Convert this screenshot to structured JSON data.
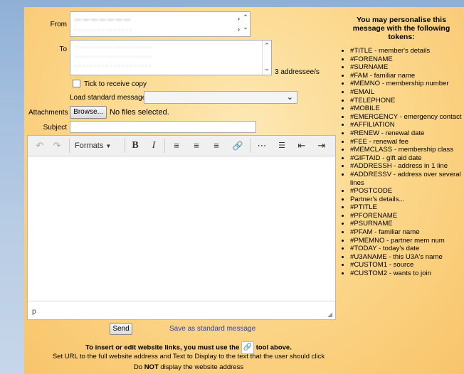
{
  "form": {
    "from_label": "From",
    "from_lines": [
      "— — — — — — — ",
      "·  · · · · · ·  · · · · · ·  · ·"
    ],
    "to_label": "To",
    "to_lines": [
      "· · · · · · · · · · · · · · · · · · · ·",
      "· · · · · · · · · · · · · · · · · · · ·",
      "· · · · · · · · · · · · · · · · · · · ·"
    ],
    "addressee_count": "3 addressee/s",
    "receive_copy_label": "Tick to receive copy",
    "load_message_label": "Load standard message",
    "load_message_value": "",
    "attachments_label": "Attachments",
    "browse_label": "Browse...",
    "files_status": "No files selected.",
    "subject_label": "Subject",
    "subject_value": ""
  },
  "editor": {
    "formats_label": "Formats",
    "status_path": "p"
  },
  "actions": {
    "send_label": "Send",
    "save_label": "Save as standard message"
  },
  "notes": {
    "line1_before": "To insert or edit website links, you must use the",
    "line1_after": "tool above.",
    "line2": "Set URL to the full website address and Text to Display to the text that the user should click",
    "line3_before": "Do",
    "line3_bold": "NOT",
    "line3_after": "display the website address"
  },
  "tokens": {
    "title": "You may personalise this message with the following tokens:",
    "items": [
      "#TITLE - member's details",
      "#FORENAME",
      "#SURNAME",
      "#FAM - familiar name",
      "#MEMNO - membership number",
      "#EMAIL",
      "#TELEPHONE",
      "#MOBILE",
      "#EMERGENCY - emergency contact",
      "#AFFILIATION",
      "#RENEW - renewal date",
      "#FEE - renewal fee",
      "#MEMCLASS - membership class",
      "#GIFTAID - gift aid date",
      "#ADDRESSH - address in 1 line",
      "#ADDRESSV - address over several lines",
      "#POSTCODE",
      "Partner's details...",
      "#PTITLE",
      "#PFORENAME",
      "#PSURNAME",
      "#PFAM - familiar name",
      "#PMEMNO - partner mem num",
      "#TODAY - today's date",
      "#U3ANAME - this U3A's name",
      "#CUSTOM1 - source",
      "#CUSTOM2 - wants to join"
    ]
  }
}
